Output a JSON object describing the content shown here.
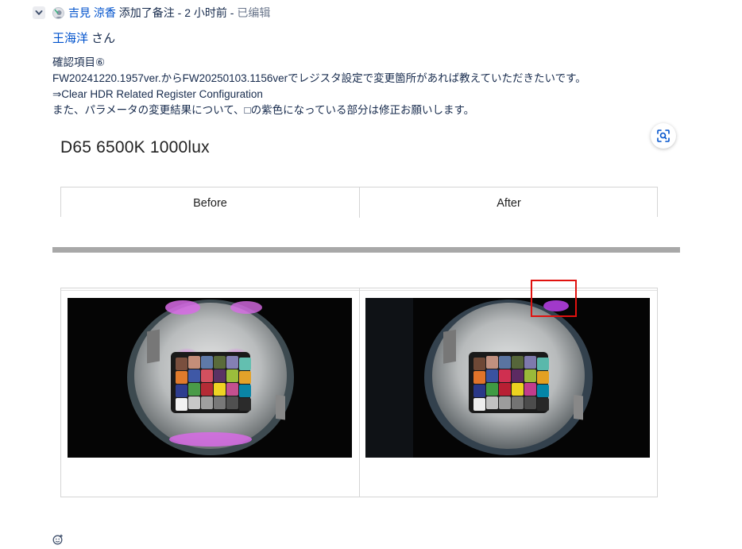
{
  "comment": {
    "author": "吉見 涼香",
    "action": "添加了备注",
    "separator1": " - ",
    "time": "2 小时前",
    "separator2": " - ",
    "edited": "已编辑",
    "mention_name": "王海洋",
    "mention_suffix": " さん",
    "lines": [
      "確認項目⑥",
      "FW20241220.1957ver.からFW20250103.1156verでレジスタ設定で変更箇所があれば教えていただきたいです。",
      "⇒Clear HDR Related Register Configuration",
      "また、パラメータの変更結果について、□の紫色になっている部分は修正お願いします。"
    ]
  },
  "attachment": {
    "title": "D65 6500K 1000lux",
    "columns": [
      "Before",
      "After"
    ]
  },
  "icons": {
    "collapse": "chevron-down-icon",
    "avatar": "avatar-icon",
    "zoom": "zoom-scan-icon",
    "reaction": "emoji-add-icon"
  },
  "colors": {
    "link": "#0052cc",
    "highlight_box": "#e0120f",
    "purple_artifact": "#d86be6"
  },
  "checker_colors_before": [
    "#7a4f3e",
    "#c48e79",
    "#5f7aa8",
    "#5a6b3a",
    "#8480b5",
    "#63bfb0",
    "#e07b2c",
    "#3f58a6",
    "#d2505f",
    "#5a3264",
    "#9bbd3c",
    "#e3a22a",
    "#2e3d8f",
    "#4a9b48",
    "#b52c36",
    "#efd323",
    "#c4508f",
    "#0a85a6",
    "#f2f2f2",
    "#c8c8c8",
    "#a0a0a0",
    "#787878",
    "#505050",
    "#2b2b2b"
  ],
  "checker_colors_after": [
    "#6e4836",
    "#c0907f",
    "#5a74a0",
    "#56663a",
    "#7e79ad",
    "#5ab8ab",
    "#e1742a",
    "#3a52a0",
    "#cf2f50",
    "#5c2a62",
    "#9ab93a",
    "#e3a022",
    "#2a3888",
    "#3f9a43",
    "#b81f33",
    "#ecd21f",
    "#c23c8c",
    "#0586a8",
    "#eeeeee",
    "#c2c2c2",
    "#9c9c9c",
    "#747474",
    "#4c4c4c",
    "#282828"
  ]
}
